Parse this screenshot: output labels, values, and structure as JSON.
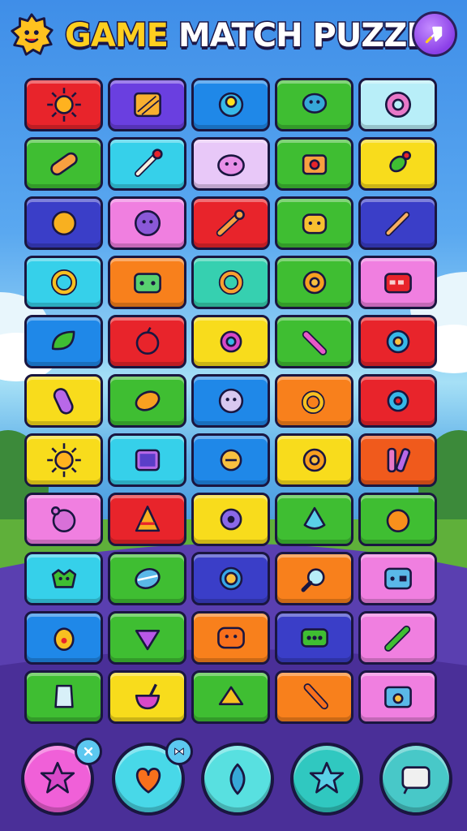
{
  "header": {
    "title_part1": "GAME",
    "title_part2": "MATCH PUZZLE",
    "logo_icon": "smiley-sun-icon",
    "settings_icon": "rocket-icon"
  },
  "colors": {
    "red": "#e8242b",
    "purple": "#6a3fe0",
    "blue": "#1f88e8",
    "green": "#3fbe32",
    "cyan": "#36d0ea",
    "lightcyan": "#b8eef8",
    "pink": "#f07fe0",
    "lavender": "#e8c8f8",
    "yellow": "#f8dc1c",
    "orange": "#f8801c",
    "teal": "#36d0b0",
    "indigo": "#3a3ec8",
    "deeporange": "#f05a1c"
  },
  "board": {
    "rows": [
      [
        {
          "color": "red",
          "icon": "sun-icon"
        },
        {
          "color": "purple",
          "icon": "crate-icon"
        },
        {
          "color": "blue",
          "icon": "gear-orb-icon"
        },
        {
          "color": "green",
          "icon": "blob-creature-icon"
        },
        {
          "color": "lightcyan",
          "icon": "donut-gear-icon"
        }
      ],
      [
        {
          "color": "green",
          "icon": "bandage-icon"
        },
        {
          "color": "cyan",
          "icon": "bone-icon"
        },
        {
          "color": "lavender",
          "icon": "monster-face-icon"
        },
        {
          "color": "green",
          "icon": "camera-icon"
        },
        {
          "color": "yellow",
          "icon": "wrapped-candy-icon"
        }
      ],
      [
        {
          "color": "indigo",
          "icon": "orange-ball-icon"
        },
        {
          "color": "pink",
          "icon": "fuzzy-monster-icon"
        },
        {
          "color": "red",
          "icon": "wrench-icon"
        },
        {
          "color": "green",
          "icon": "cat-face-icon"
        },
        {
          "color": "indigo",
          "icon": "pencil-icon"
        }
      ],
      [
        {
          "color": "cyan",
          "icon": "ring-icon"
        },
        {
          "color": "orange",
          "icon": "toy-block-icon"
        },
        {
          "color": "teal",
          "icon": "ring-gear-icon"
        },
        {
          "color": "green",
          "icon": "cog-sun-icon"
        },
        {
          "color": "pink",
          "icon": "radio-icon"
        }
      ],
      [
        {
          "color": "blue",
          "icon": "leaf-creature-icon"
        },
        {
          "color": "red",
          "icon": "apple-icon"
        },
        {
          "color": "yellow",
          "icon": "lens-gear-icon"
        },
        {
          "color": "green",
          "icon": "ice-cream-icon"
        },
        {
          "color": "red",
          "icon": "snail-gear-icon"
        }
      ],
      [
        {
          "color": "yellow",
          "icon": "capsule-icon"
        },
        {
          "color": "green",
          "icon": "lemon-icon"
        },
        {
          "color": "blue",
          "icon": "face-ball-icon"
        },
        {
          "color": "orange",
          "icon": "knot-ring-icon"
        },
        {
          "color": "red",
          "icon": "bow-gear-icon"
        }
      ],
      [
        {
          "color": "yellow",
          "icon": "sun-icon"
        },
        {
          "color": "cyan",
          "icon": "tablet-icon"
        },
        {
          "color": "blue",
          "icon": "lock-ring-icon"
        },
        {
          "color": "yellow",
          "icon": "cog-sun-icon"
        },
        {
          "color": "deeporange",
          "icon": "double-bar-icon"
        }
      ],
      [
        {
          "color": "pink",
          "icon": "bear-face-icon"
        },
        {
          "color": "red",
          "icon": "cone-icon"
        },
        {
          "color": "yellow",
          "icon": "virus-gear-icon"
        },
        {
          "color": "green",
          "icon": "crystal-icon"
        },
        {
          "color": "green",
          "icon": "orange-creature-icon"
        }
      ],
      [
        {
          "color": "cyan",
          "icon": "dragon-face-icon"
        },
        {
          "color": "green",
          "icon": "egg-stripe-icon"
        },
        {
          "color": "indigo",
          "icon": "sun-face-icon"
        },
        {
          "color": "orange",
          "icon": "magnifier-icon"
        },
        {
          "color": "pink",
          "icon": "gameboy-icon"
        }
      ],
      [
        {
          "color": "blue",
          "icon": "egg-dot-icon"
        },
        {
          "color": "green",
          "icon": "triangle-gem-icon"
        },
        {
          "color": "orange",
          "icon": "monster-box-icon"
        },
        {
          "color": "indigo",
          "icon": "game-console-icon"
        },
        {
          "color": "pink",
          "icon": "candy-stick-icon"
        }
      ],
      [
        {
          "color": "green",
          "icon": "jar-icon"
        },
        {
          "color": "yellow",
          "icon": "mortar-icon"
        },
        {
          "color": "green",
          "icon": "cheese-icon"
        },
        {
          "color": "orange",
          "icon": "carrot-icon"
        },
        {
          "color": "pink",
          "icon": "film-box-icon"
        }
      ]
    ]
  },
  "toolbar": [
    {
      "name": "star-monster-tool",
      "color": "#f060d8",
      "icon": "star-monster-icon",
      "badge": "x-badge-icon"
    },
    {
      "name": "heart-tool",
      "color": "#48d8e8",
      "icon": "heart-icon",
      "badge": "bow-badge-icon"
    },
    {
      "name": "leaf-tool",
      "color": "#58e0e0",
      "icon": "leaf-icon",
      "badge": ""
    },
    {
      "name": "star-tool",
      "color": "#30c8c0",
      "icon": "star-icon",
      "badge": ""
    },
    {
      "name": "sign-tool",
      "color": "#48c8c8",
      "icon": "sign-icon",
      "badge": ""
    }
  ]
}
